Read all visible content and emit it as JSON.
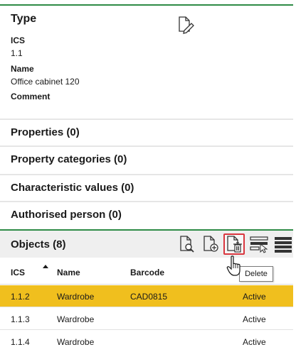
{
  "type_section": {
    "title": "Type",
    "ics_label": "ICS",
    "ics_value": "1.1",
    "name_label": "Name",
    "name_value": "Office cabinet 120",
    "comment_label": "Comment"
  },
  "sections": {
    "properties": "Properties (0)",
    "property_categories": "Property categories (0)",
    "characteristic_values": "Characteristic values (0)",
    "authorised_person": "Authorised person (0)"
  },
  "objects": {
    "title": "Objects (8)",
    "toolbar": {
      "search_icon": "document-search-icon",
      "add_icon": "document-add-icon",
      "delete_icon": "document-delete-icon",
      "select_icon": "select-list-icon",
      "menu_icon": "menu-lines-icon"
    },
    "tooltip": "Delete",
    "columns": {
      "ics": "ICS",
      "name": "Name",
      "barcode": "Barcode"
    },
    "rows": [
      {
        "ics": "1.1.2",
        "name": "Wardrobe",
        "barcode": "CAD0815",
        "status": "Active"
      },
      {
        "ics": "1.1.3",
        "name": "Wardrobe",
        "barcode": "",
        "status": "Active"
      },
      {
        "ics": "1.1.4",
        "name": "Wardrobe",
        "barcode": "",
        "status": "Active"
      }
    ]
  },
  "colors": {
    "accent_green": "#2e8b46",
    "selected_row": "#f0bf1e",
    "highlight_border": "#d9363e"
  }
}
